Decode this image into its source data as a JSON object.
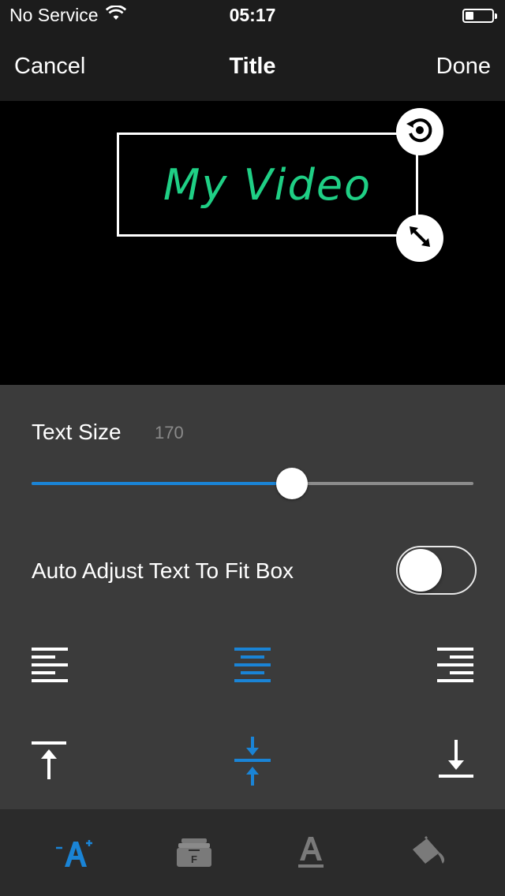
{
  "status_bar": {
    "carrier": "No Service",
    "time": "05:17",
    "wifi_icon": "wifi-icon",
    "battery_icon": "battery-icon"
  },
  "nav": {
    "cancel_label": "Cancel",
    "title": "Title",
    "done_label": "Done"
  },
  "canvas": {
    "title_text": "My Video",
    "title_color": "#1fcf85",
    "rotate_icon": "rotate-icon",
    "resize_icon": "resize-icon"
  },
  "panel": {
    "text_size_label": "Text Size",
    "text_size_value": "170",
    "slider_fraction": 0.59,
    "auto_adjust_label": "Auto Adjust Text To Fit Box",
    "auto_adjust_on": false,
    "horizontal_alignment": [
      "align-left-icon",
      "align-center-icon",
      "align-right-icon"
    ],
    "horizontal_selected": "center",
    "vertical_alignment": [
      "align-top-icon",
      "align-middle-icon",
      "align-bottom-icon"
    ],
    "vertical_selected": "middle",
    "accent_color": "#1a84d6"
  },
  "tabbar": {
    "tabs": [
      "text-size-icon",
      "font-icon",
      "text-color-icon",
      "fill-color-icon"
    ],
    "selected_tab": "text-size-icon"
  }
}
